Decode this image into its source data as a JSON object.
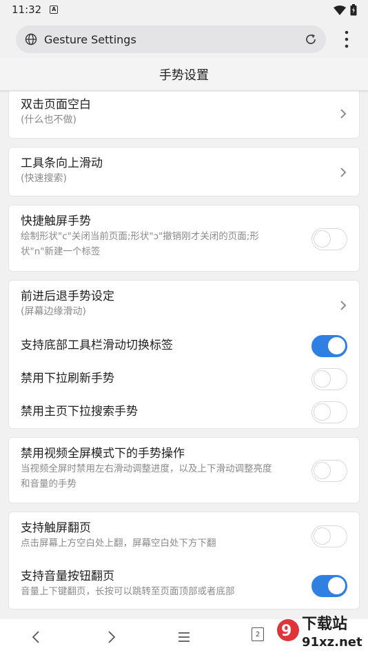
{
  "status_bar": {
    "time": "11:32",
    "badge": "A"
  },
  "url_bar": {
    "text": "Gesture Settings"
  },
  "header": {
    "title": "手势设置",
    "ghost": ""
  },
  "cards": [
    {
      "rows": [
        {
          "title": "双击页面空白",
          "subtitle": "(什么也不做)",
          "control": "chevron"
        }
      ]
    },
    {
      "rows": [
        {
          "title": "工具条向上滑动",
          "subtitle": "(快速搜索)",
          "control": "chevron"
        }
      ]
    },
    {
      "rows": [
        {
          "title": "快捷触屏手势",
          "subtitle_line1": "绘制形状\"c\"关闭当前页面;形状\"ɔ\"撤销刚才关闭的页面;形",
          "subtitle_line2": "状\"n\"新建一个标签",
          "control": "toggle",
          "on": false
        }
      ]
    },
    {
      "rows": [
        {
          "title": "前进后退手势设定",
          "subtitle": "(屏幕边缘滑动)",
          "control": "chevron"
        },
        {
          "title": "支持底部工具栏滑动切换标签",
          "control": "toggle",
          "on": true
        },
        {
          "title": "禁用下拉刷新手势",
          "control": "toggle",
          "on": false
        },
        {
          "title": "禁用主页下拉搜索手势",
          "control": "toggle",
          "on": false
        }
      ]
    },
    {
      "rows": [
        {
          "title": "禁用视频全屏模式下的手势操作",
          "subtitle_line1": "当视频全屏时禁用左右滑动调整进度，以及上下滑动调整亮度",
          "subtitle_line2": "和音量的手势",
          "control": "toggle",
          "on": false
        }
      ]
    },
    {
      "rows": [
        {
          "title": "支持触屏翻页",
          "subtitle": "点击屏幕上方空白处上翻，屏幕空白处下方下翻",
          "control": "toggle",
          "on": false
        },
        {
          "title": "支持音量按钮翻页",
          "subtitle": "音量上下键翻页，长按可以跳转至页面顶部或者底部",
          "control": "toggle",
          "on": true
        }
      ]
    }
  ],
  "bottom_nav": {
    "tab_count": "2",
    "watermark_top": "下载站",
    "watermark_bottom": "91xz.net"
  },
  "colors": {
    "accent": "#2f80e2",
    "background": "#f1f1f1",
    "card": "#ffffff"
  }
}
